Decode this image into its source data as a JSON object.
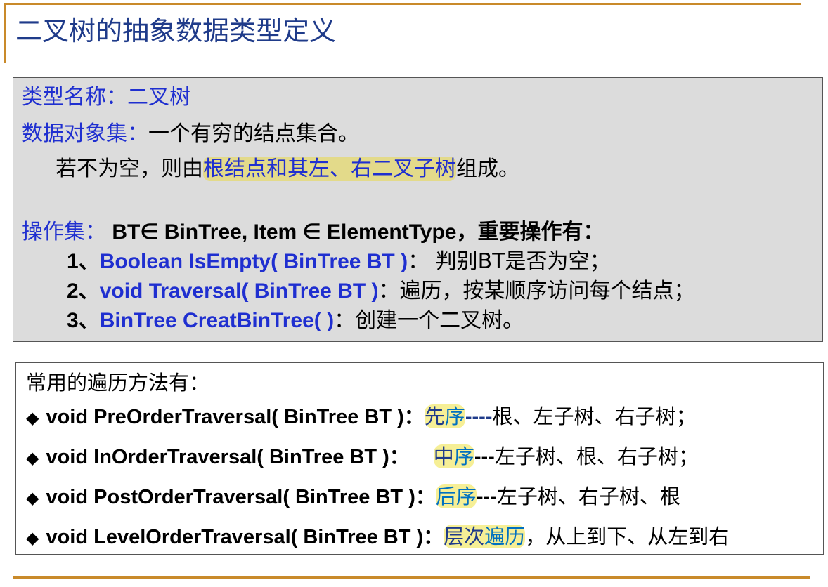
{
  "title": "二叉树的抽象数据类型定义",
  "adt": {
    "type_label": "类型名称：",
    "type_value": "二叉树",
    "dataset_label": "数据对象集：",
    "dataset_value": "一个有穷的结点集合。",
    "nonempty_prefix": "若不为空，则由",
    "nonempty_highlight": "根结点和其左、右二叉子树",
    "nonempty_suffix": "组成。",
    "ops_label": "操作集：",
    "ops_header": " BT∈ BinTree, Item ∈ ElementType，重要操作有：",
    "ops": [
      {
        "num": "1、",
        "sig": "Boolean IsEmpty( BinTree BT )",
        "desc": "： 判别BT是否为空；"
      },
      {
        "num": "2、",
        "sig": "void Traversal( BinTree BT )",
        "desc": "：遍历，按某顺序访问每个结点；"
      },
      {
        "num": "3、",
        "sig": "BinTree CreatBinTree( )",
        "desc": "：创建一个二叉树。"
      }
    ]
  },
  "traversals": {
    "heading": "常用的遍历方法有：",
    "bullet": "◆",
    "items": [
      {
        "sig": "void PreOrderTraversal( BinTree BT )：",
        "name_a": "先",
        "name_b": "序",
        "dash": "----",
        "desc": "根、左子树、右子树；"
      },
      {
        "sig": "void InOrderTraversal( BinTree BT )：",
        "name_a": "中",
        "name_b": "序",
        "dash": "---",
        "desc": "左子树、根、右子树；"
      },
      {
        "sig": "void PostOrderTraversal( BinTree BT )：",
        "name_a": "后",
        "name_b": "序",
        "dash": "---",
        "desc": "左子树、右子树、根"
      },
      {
        "sig": "void LevelOrderTraversal( BinTree BT )：",
        "name_a": "层次",
        "name_b": "遍历",
        "dash": "",
        "desc": "，从上到下、从左到右"
      }
    ]
  }
}
